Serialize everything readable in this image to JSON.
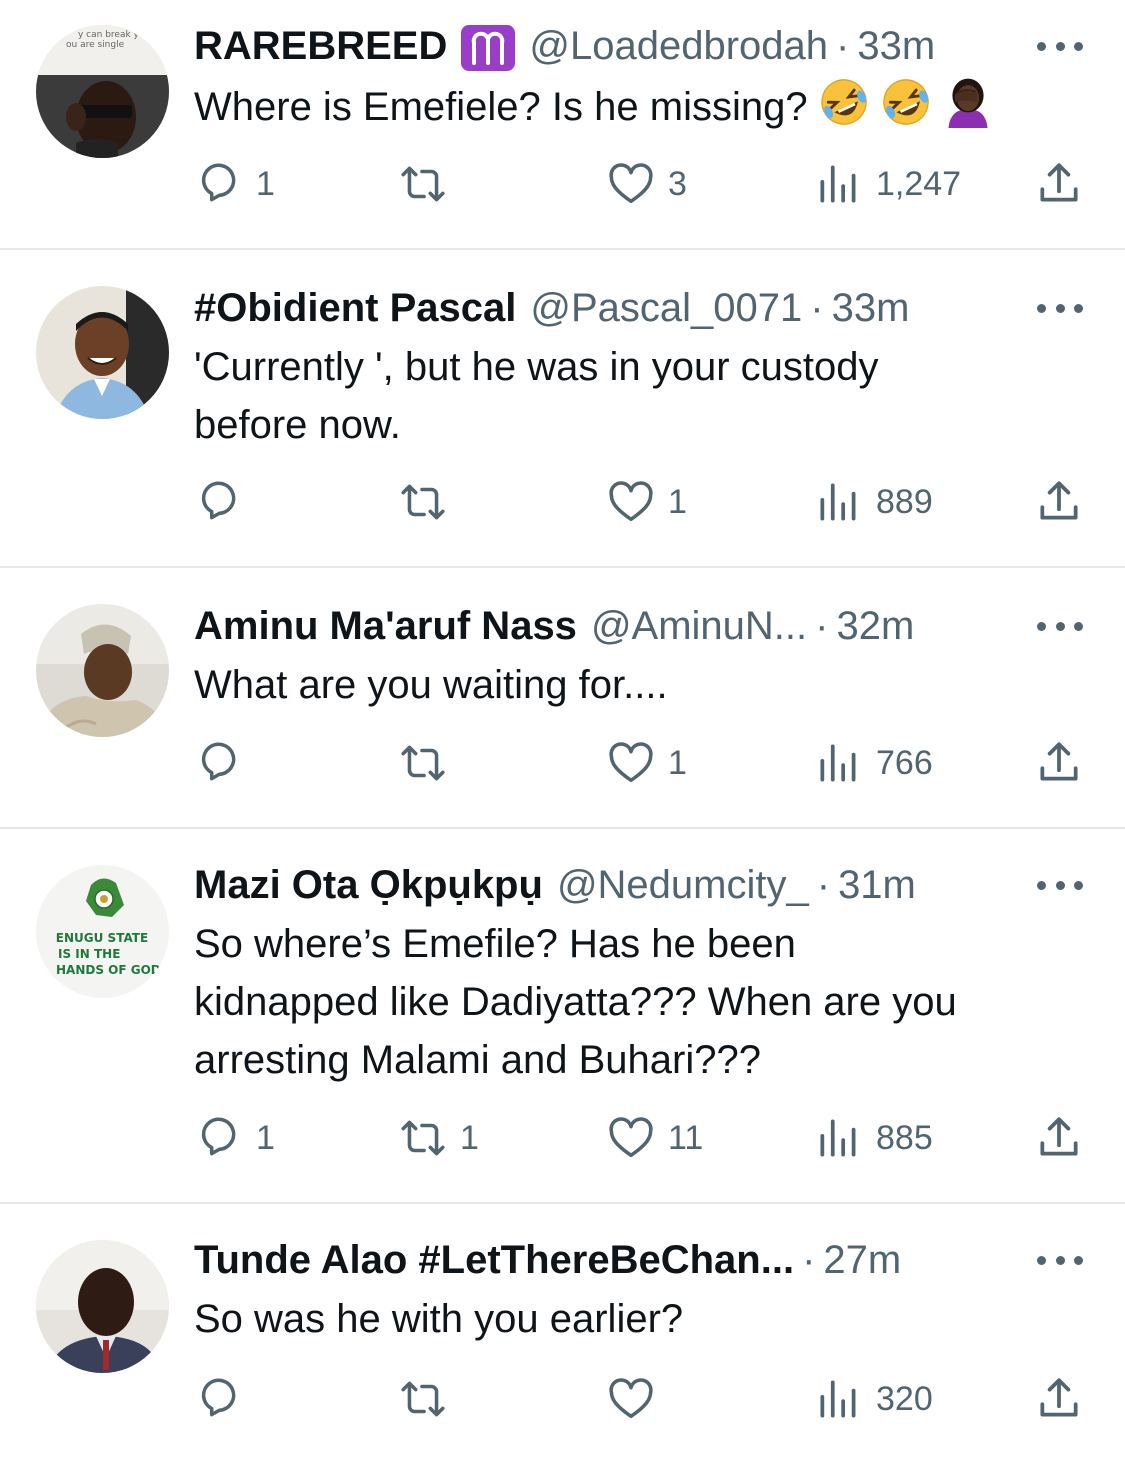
{
  "colors": {
    "text_primary": "#0f1419",
    "text_secondary": "#536471",
    "divider": "#e3e6ea",
    "aries_badge": "#9b3ec7"
  },
  "tweets": [
    {
      "name": "RAREBREED",
      "badge": "aries-icon",
      "handle": "@Loadedbrodah",
      "dot": "·",
      "time": "33m",
      "text": "Where is Emefiele? Is he missing?",
      "emojis": [
        "rolling-laughing-emoji",
        "rolling-laughing-emoji",
        "facepalm-emoji"
      ],
      "avatar_caption": "y can break you. ou are single",
      "reply_count": "1",
      "retweet_count": "",
      "like_count": "3",
      "view_count": "1,247"
    },
    {
      "name": "#Obidient Pascal",
      "handle": "@Pascal_0071",
      "dot": "·",
      "time": "33m",
      "text": "'Currently ', but he was in your custody\nbefore now.",
      "reply_count": "",
      "retweet_count": "",
      "like_count": "1",
      "view_count": "889"
    },
    {
      "name": "Aminu Ma'aruf Nass",
      "handle": "@AminuN...",
      "dot": "·",
      "time": "32m",
      "text": "What are you waiting for....",
      "reply_count": "",
      "retweet_count": "",
      "like_count": "1",
      "view_count": "766"
    },
    {
      "name": "Mazi Ota Ọkpụkpụ",
      "handle": "@Nedumcity_",
      "dot": "·",
      "time": "31m",
      "text": "So where’s Emefile? Has he been\nkidnapped like Dadiyatta??? When are you\narresting Malami and Buhari???",
      "avatar_caption": [
        "ENUGU STATE",
        "IS IN THE",
        "HANDS OF GOD"
      ],
      "reply_count": "1",
      "retweet_count": "1",
      "like_count": "11",
      "view_count": "885"
    },
    {
      "name": "Tunde Alao #LetThereBeChan...",
      "handle": "",
      "dot": "·",
      "time": "27m",
      "text": "So was he with you earlier?",
      "reply_count": "",
      "retweet_count": "",
      "like_count": "",
      "view_count": "320"
    }
  ]
}
